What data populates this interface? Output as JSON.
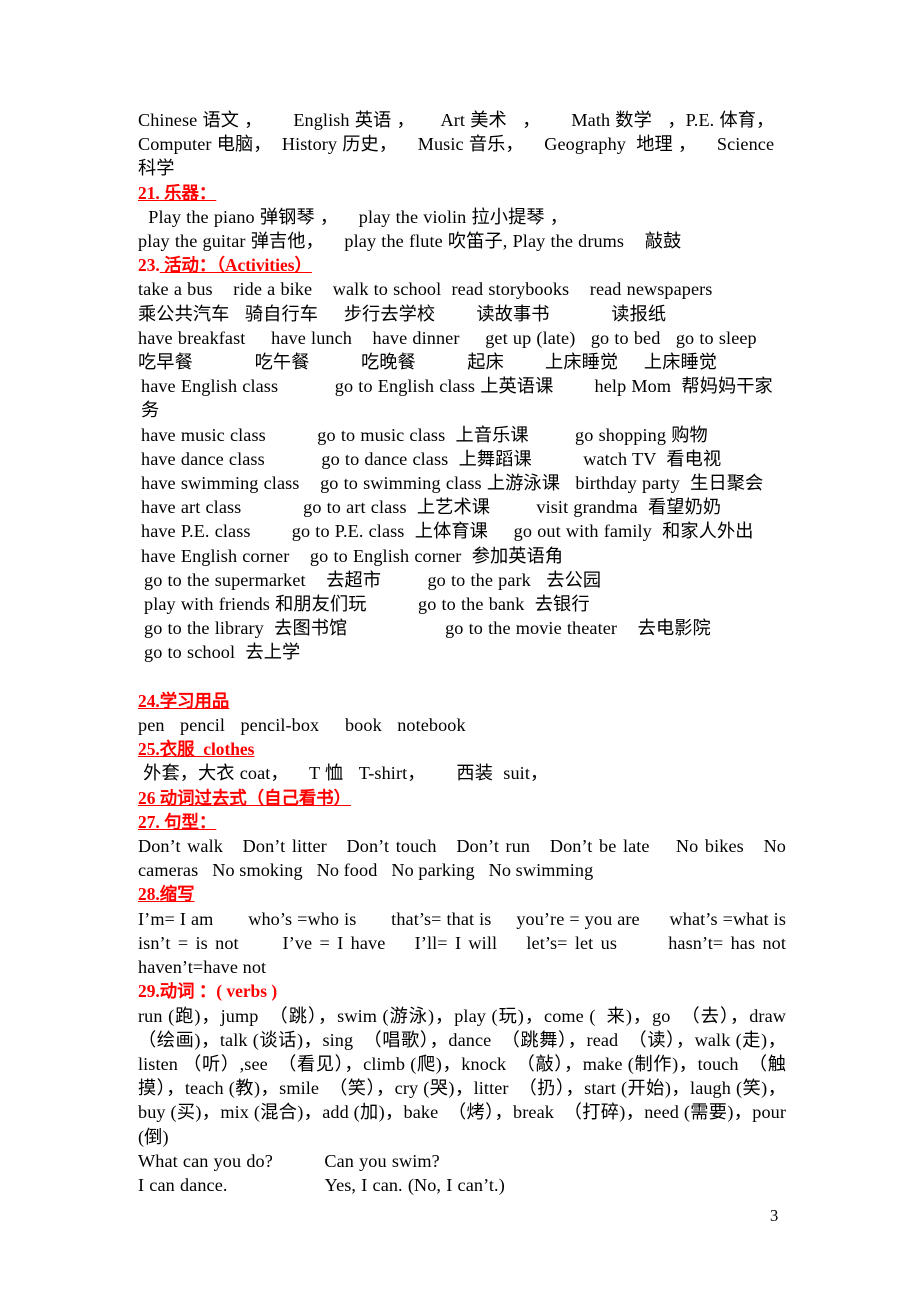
{
  "document": {
    "page_number": "3",
    "heading_color": "#ff0000",
    "body_color": "#000000"
  },
  "subjects": {
    "line1": "Chinese 语文 ，      English 英语 ，     Art 美术   ，      Math 数学   ，P.E. 体育，",
    "line2": "Computer 电脑，  History 历史，    Music 音乐，    Geography  地理 ，    Science",
    "line3": "科学"
  },
  "sections": {
    "instruments": {
      "number": "21.",
      "title": " 乐器：",
      "line1": "  Play the piano 弹钢琴 ，    play the violin 拉小提琴 ，",
      "line2": "play the guitar 弹吉他，    play the flute 吹笛子, Play the drums    敲鼓"
    },
    "activities": {
      "number": "23.",
      "title": " 活动：（Activities）",
      "rows": [
        "take a bus    ride a bike    walk to school  read storybooks    read newspapers",
        "乘公共汽车   骑自行车     步行去学校        读故事书            读报纸",
        "have breakfast     have lunch    have dinner     get up (late)   go to bed   go to sleep",
        "吃早餐            吃午餐          吃晚餐          起床        上床睡觉     上床睡觉",
        "have English class           go to English class 上英语课        help Mom  帮妈妈干家务",
        "have music class          go to music class  上音乐课         go shopping 购物",
        "have dance class           go to dance class  上舞蹈课          watch TV  看电视",
        "have swimming class    go to swimming class 上游泳课   birthday party  生日聚会",
        "have art class            go to art class  上艺术课         visit grandma  看望奶奶",
        "have P.E. class        go to P.E. class  上体育课     go out with family  和家人外出",
        "have English corner    go to English corner  参加英语角",
        "go to the supermarket    去超市         go to the park   去公园",
        "play with friends 和朋友们玩          go to the bank  去银行",
        "go to the library  去图书馆                   go to the movie theater    去电影院",
        "go to school  去上学"
      ]
    },
    "school_supplies": {
      "number": "24.",
      "title": "学习用品",
      "line1": "pen   pencil   pencil-box     book   notebook"
    },
    "clothes": {
      "number": "25.",
      "title": "衣服  clothes",
      "line1": " 外套，大衣 coat，    T 恤   T-shirt，      西装  suit，"
    },
    "past_tense": {
      "number": "26",
      "title": " 动词过去式（自己看书）"
    },
    "sentence_patterns": {
      "number": "27.",
      "title": " 句型：",
      "body": "Don’t walk   Don’t litter   Don’t touch   Don’t run   Don’t be late    No bikes   No cameras   No smoking   No food   No parking   No swimming"
    },
    "contractions": {
      "number": "28.",
      "title": "缩写",
      "body": "I’m= I am       who’s =who is       that’s= that is     you’re = you are      what’s =what is    isn’t = is not      I’ve = I have    I’ll= I will    let’s= let us       hasn’t= has not haven’t=have not"
    },
    "verbs": {
      "number": "29.",
      "title": "动词 ：( verbs )",
      "body": "run (跑)，jump  （跳），swim (游泳)，play (玩)，come (  来)，go  （去），draw （绘画)，talk (谈话)，sing  （唱歌），dance  （跳舞），read  （读），walk (走)，listen （听）,see  （看见），climb (爬)，knock  （敲），make (制作)，touch  （触摸），teach (教)，smile  （笑），cry (哭)，litter  （扔），start (开始)，laugh (笑)，buy (买)，mix (混合)，add (加)，bake  （烤），break  （打碎)，need (需要)，pour (倒)",
      "q1": "What can you do?          Can you swim?",
      "a1": "I can dance.                   Yes, I can. (No, I can’t.)"
    }
  }
}
